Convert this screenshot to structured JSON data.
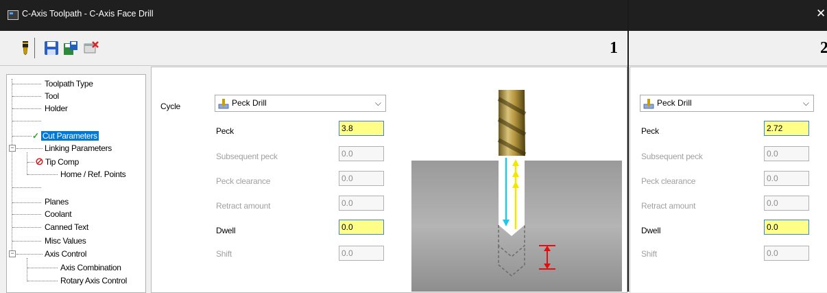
{
  "window": {
    "title": "C-Axis Toolpath - C-Axis Face Drill",
    "close_glyph": "✕"
  },
  "toolbar": {
    "icons": [
      "tool-icon",
      "save-icon",
      "save-as-icon",
      "close-operation-icon"
    ]
  },
  "compare": {
    "left_number": "1",
    "right_number": "2"
  },
  "tree": {
    "items": [
      {
        "label": "Toolpath Type"
      },
      {
        "label": "Tool"
      },
      {
        "label": "Holder"
      },
      {
        "label": "Cut Parameters",
        "selected": true,
        "icon": "checkmark-icon"
      },
      {
        "label": "Linking Parameters"
      },
      {
        "label": "Tip Comp",
        "icon": "disabled-icon"
      },
      {
        "label": "Home / Ref. Points"
      },
      {
        "label": "Planes"
      },
      {
        "label": "Coolant"
      },
      {
        "label": "Canned Text"
      },
      {
        "label": "Misc Values"
      },
      {
        "label": "Axis Control"
      },
      {
        "label": "Axis Combination"
      },
      {
        "label": "Rotary Axis Control"
      }
    ]
  },
  "left_panel": {
    "cycle_label": "Cycle",
    "cycle_value": "Peck Drill",
    "fields": [
      {
        "label": "Peck",
        "value": "3.8",
        "enabled": true
      },
      {
        "label": "Subsequent peck",
        "value": "0.0",
        "enabled": false
      },
      {
        "label": "Peck clearance",
        "value": "0.0",
        "enabled": false
      },
      {
        "label": "Retract amount",
        "value": "0.0",
        "enabled": false
      },
      {
        "label": "Dwell",
        "value": "0.0",
        "enabled": true
      },
      {
        "label": "Shift",
        "value": "0.0",
        "enabled": false
      }
    ]
  },
  "right_panel": {
    "cycle_value": "Peck Drill",
    "fields": [
      {
        "label": "Peck",
        "value": "2.72",
        "enabled": true
      },
      {
        "label": "Subsequent peck",
        "value": "0.0",
        "enabled": false
      },
      {
        "label": "Peck clearance",
        "value": "0.0",
        "enabled": false
      },
      {
        "label": "Retract amount",
        "value": "0.0",
        "enabled": false
      },
      {
        "label": "Dwell",
        "value": "0.0",
        "enabled": true
      },
      {
        "label": "Shift",
        "value": "0.0",
        "enabled": false
      }
    ]
  },
  "colors": {
    "highlight_input": "#ffff88",
    "selection": "#0078d7",
    "arrow_down": "#22c7e8",
    "arrow_up": "#f5e600",
    "dimension": "#e01010"
  }
}
